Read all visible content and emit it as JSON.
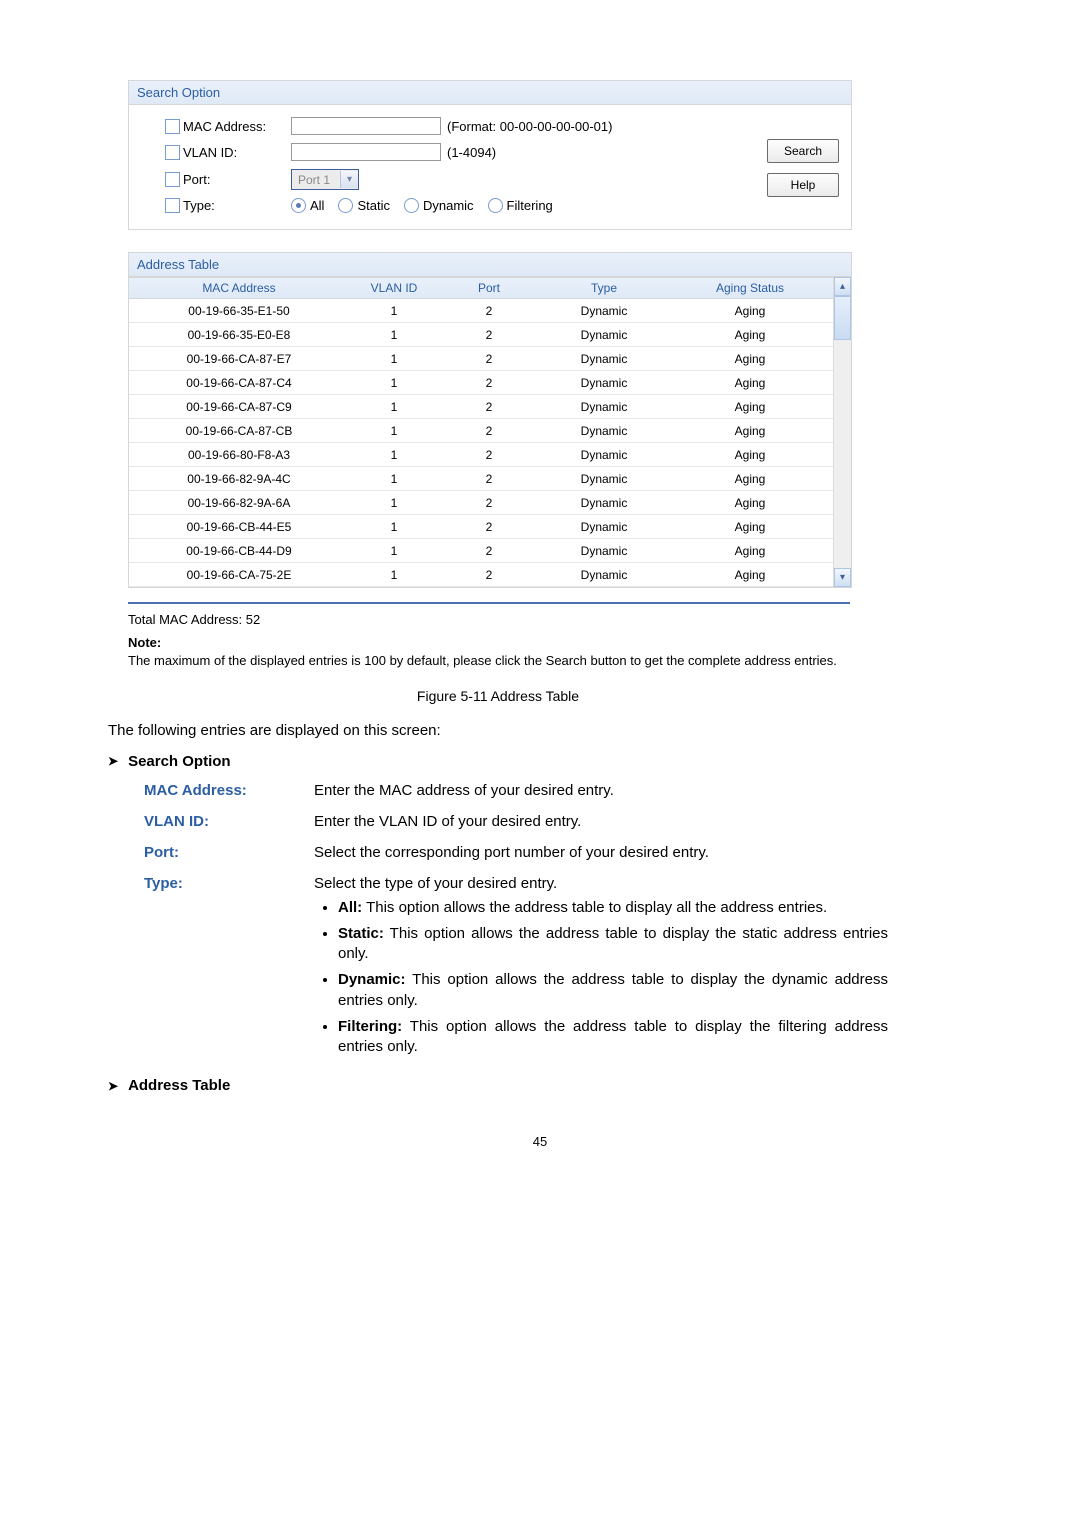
{
  "searchOption": {
    "header": "Search Option",
    "macLabel": "MAC Address:",
    "macHint": "(Format: 00-00-00-00-00-01)",
    "vlanLabel": "VLAN ID:",
    "vlanHint": "(1-4094)",
    "portLabel": "Port:",
    "portValue": "Port 1",
    "typeLabel": "Type:",
    "typeOptions": {
      "all": "All",
      "static": "Static",
      "dynamic": "Dynamic",
      "filtering": "Filtering"
    },
    "searchBtn": "Search",
    "helpBtn": "Help"
  },
  "addressTable": {
    "header": "Address Table",
    "columns": {
      "mac": "MAC Address",
      "vlan": "VLAN ID",
      "port": "Port",
      "type": "Type",
      "aging": "Aging Status"
    },
    "rows": [
      {
        "mac": "00-19-66-35-E1-50",
        "vlan": "1",
        "port": "2",
        "type": "Dynamic",
        "aging": "Aging"
      },
      {
        "mac": "00-19-66-35-E0-E8",
        "vlan": "1",
        "port": "2",
        "type": "Dynamic",
        "aging": "Aging"
      },
      {
        "mac": "00-19-66-CA-87-E7",
        "vlan": "1",
        "port": "2",
        "type": "Dynamic",
        "aging": "Aging"
      },
      {
        "mac": "00-19-66-CA-87-C4",
        "vlan": "1",
        "port": "2",
        "type": "Dynamic",
        "aging": "Aging"
      },
      {
        "mac": "00-19-66-CA-87-C9",
        "vlan": "1",
        "port": "2",
        "type": "Dynamic",
        "aging": "Aging"
      },
      {
        "mac": "00-19-66-CA-87-CB",
        "vlan": "1",
        "port": "2",
        "type": "Dynamic",
        "aging": "Aging"
      },
      {
        "mac": "00-19-66-80-F8-A3",
        "vlan": "1",
        "port": "2",
        "type": "Dynamic",
        "aging": "Aging"
      },
      {
        "mac": "00-19-66-82-9A-4C",
        "vlan": "1",
        "port": "2",
        "type": "Dynamic",
        "aging": "Aging"
      },
      {
        "mac": "00-19-66-82-9A-6A",
        "vlan": "1",
        "port": "2",
        "type": "Dynamic",
        "aging": "Aging"
      },
      {
        "mac": "00-19-66-CB-44-E5",
        "vlan": "1",
        "port": "2",
        "type": "Dynamic",
        "aging": "Aging"
      },
      {
        "mac": "00-19-66-CB-44-D9",
        "vlan": "1",
        "port": "2",
        "type": "Dynamic",
        "aging": "Aging"
      },
      {
        "mac": "00-19-66-CA-75-2E",
        "vlan": "1",
        "port": "2",
        "type": "Dynamic",
        "aging": "Aging"
      }
    ]
  },
  "totalLine": "Total MAC Address: 52",
  "noteTitle": "Note:",
  "noteText": "The maximum of the displayed entries is 100 by default, please click the Search button to get the complete address entries.",
  "figureCaption": "Figure 5-11 Address Table",
  "intro": "The following entries are displayed on this screen:",
  "sectionSearch": "Search Option",
  "defs": {
    "mac": {
      "term": "MAC Address:",
      "desc": "Enter the MAC address of your desired entry."
    },
    "vlan": {
      "term": "VLAN ID:",
      "desc": "Enter the VLAN ID of your desired entry."
    },
    "port": {
      "term": "Port:",
      "desc": "Select the corresponding port number of your desired entry."
    },
    "type": {
      "term": "Type:",
      "desc": "Select the type of your desired entry.",
      "options": {
        "all": {
          "name": "All:",
          "text": " This option allows the address table to display all the address entries."
        },
        "static": {
          "name": "Static:",
          "text": " This option allows the address table to display the static address entries only."
        },
        "dynamic": {
          "name": "Dynamic:",
          "text": " This option allows the address table to display the dynamic address entries only."
        },
        "filtering": {
          "name": "Filtering:",
          "text": " This option allows the address table to display the filtering address entries only."
        }
      }
    }
  },
  "sectionTable": "Address Table",
  "pageNum": "45"
}
